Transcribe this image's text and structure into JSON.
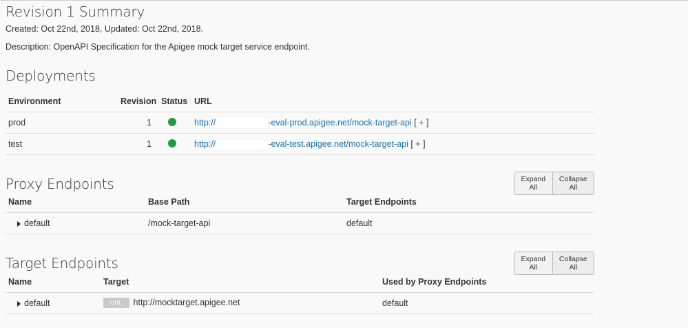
{
  "summary": {
    "title": "Revision 1 Summary",
    "created_line": "Created: Oct 22nd, 2018, Updated: Oct 22nd, 2018.",
    "description_line": "Description: OpenAPI Specification for the Apigee mock target service endpoint."
  },
  "deployments": {
    "title": "Deployments",
    "headers": {
      "environment": "Environment",
      "revision": "Revision",
      "status": "Status",
      "url": "URL"
    },
    "rows": [
      {
        "environment": "prod",
        "revision": "1",
        "status_color": "#1e9e3a",
        "url_prefix": "http://",
        "url_suffix": "-eval-prod.apigee.net/mock-target-api",
        "expand": "[ + ]"
      },
      {
        "environment": "test",
        "revision": "1",
        "status_color": "#1e9e3a",
        "url_prefix": "http://",
        "url_suffix": "-eval-test.apigee.net/mock-target-api",
        "expand": "[ + ]"
      }
    ]
  },
  "proxy_endpoints": {
    "title": "Proxy Endpoints",
    "expand_all": "Expand All",
    "collapse_all": "Collapse All",
    "headers": {
      "name": "Name",
      "base_path": "Base Path",
      "target_endpoints": "Target Endpoints"
    },
    "rows": [
      {
        "name": "default",
        "base_path": "/mock-target-api",
        "target_endpoints": "default"
      }
    ]
  },
  "target_endpoints": {
    "title": "Target Endpoints",
    "expand_all": "Expand All",
    "collapse_all": "Collapse All",
    "headers": {
      "name": "Name",
      "target": "Target",
      "used_by": "Used by Proxy Endpoints"
    },
    "rows": [
      {
        "name": "default",
        "target_badge": "URL",
        "target": "http://mocktarget.apigee.net",
        "used_by": "default"
      }
    ]
  },
  "colors": {
    "link": "#1a73b8",
    "status_ok": "#1e9e3a",
    "background": "#f8f9f8"
  }
}
